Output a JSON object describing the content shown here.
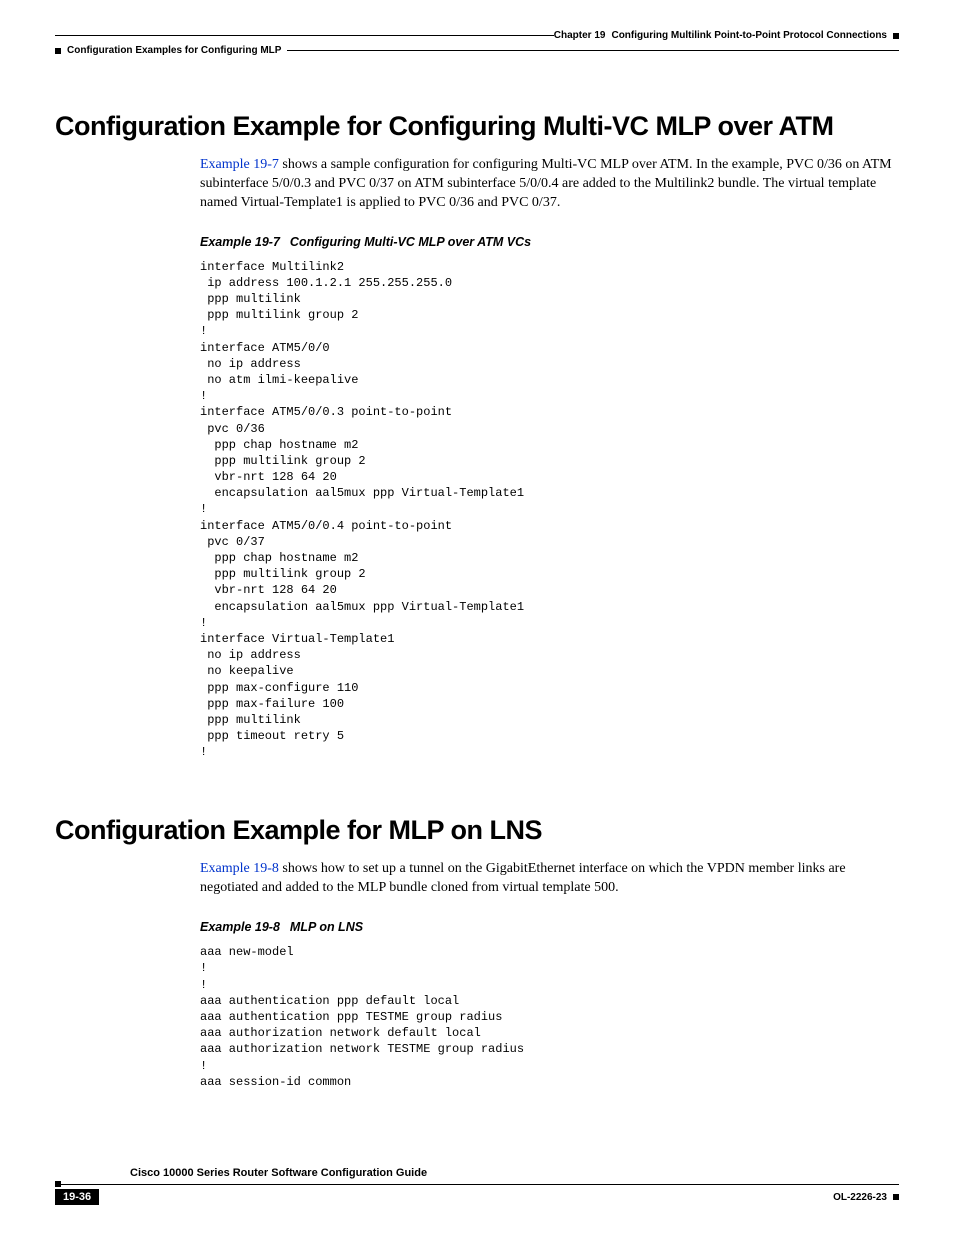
{
  "header": {
    "chapter_label": "Chapter 19",
    "chapter_title": "Configuring Multilink Point-to-Point Protocol Connections",
    "section_breadcrumb": "Configuration Examples for Configuring MLP"
  },
  "section1": {
    "title": "Configuration Example for Configuring Multi-VC MLP over ATM",
    "link": "Example 19-7",
    "para_rest": " shows a sample configuration for configuring Multi-VC MLP over ATM. In the example, PVC 0/36 on ATM subinterface 5/0/0.3 and PVC 0/37 on ATM subinterface 5/0/0.4 are added to the Multilink2 bundle. The virtual template named Virtual-Template1 is applied to PVC 0/36 and PVC 0/37.",
    "example_num": "Example 19-7",
    "example_title": "Configuring Multi-VC MLP over ATM VCs",
    "code": "interface Multilink2\n ip address 100.1.2.1 255.255.255.0\n ppp multilink\n ppp multilink group 2\n!\ninterface ATM5/0/0\n no ip address\n no atm ilmi-keepalive\n!\ninterface ATM5/0/0.3 point-to-point\n pvc 0/36\n  ppp chap hostname m2\n  ppp multilink group 2\n  vbr-nrt 128 64 20\n  encapsulation aal5mux ppp Virtual-Template1\n!\ninterface ATM5/0/0.4 point-to-point\n pvc 0/37\n  ppp chap hostname m2\n  ppp multilink group 2\n  vbr-nrt 128 64 20\n  encapsulation aal5mux ppp Virtual-Template1\n!\ninterface Virtual-Template1\n no ip address\n no keepalive\n ppp max-configure 110\n ppp max-failure 100\n ppp multilink\n ppp timeout retry 5\n!"
  },
  "section2": {
    "title": "Configuration Example for MLP on LNS",
    "link": "Example 19-8",
    "para_rest": " shows how to set up a tunnel on the GigabitEthernet interface on which the VPDN member links are negotiated and added to the MLP bundle cloned from virtual template 500.",
    "example_num": "Example 19-8",
    "example_title": "MLP on LNS",
    "code": "aaa new-model\n!\n!\naaa authentication ppp default local\naaa authentication ppp TESTME group radius\naaa authorization network default local\naaa authorization network TESTME group radius\n!\naaa session-id common"
  },
  "footer": {
    "guide": "Cisco 10000 Series Router Software Configuration Guide",
    "page": "19-36",
    "doc_id": "OL-2226-23"
  }
}
